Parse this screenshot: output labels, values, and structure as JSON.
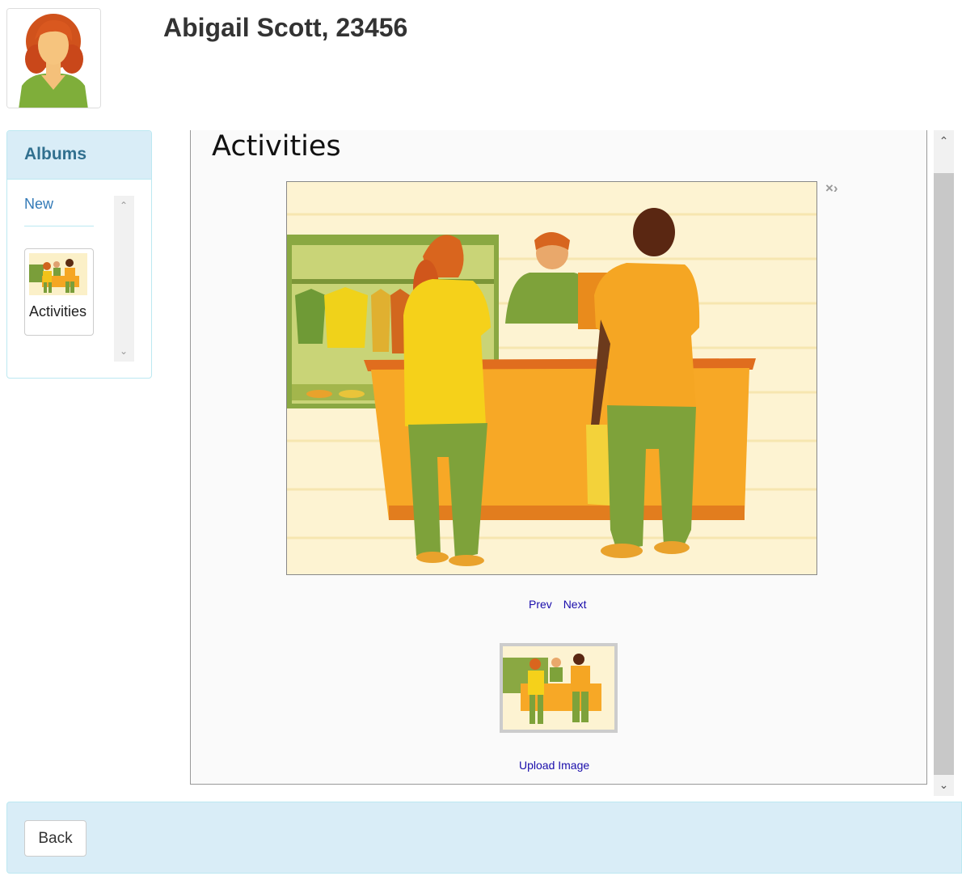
{
  "header": {
    "title": "Abigail Scott, 23456",
    "avatar_icon": "person-avatar-icon"
  },
  "albums": {
    "heading": "Albums",
    "new_label": "New",
    "items": [
      {
        "label": "Activities"
      }
    ]
  },
  "viewer": {
    "album_title": "Activities",
    "close_label": "×›",
    "prev_label": "Prev",
    "next_label": "Next",
    "upload_label": "Upload Image"
  },
  "footer": {
    "back_label": "Back"
  },
  "colors": {
    "panel_heading_bg": "#d9edf7",
    "panel_border": "#bce8f1",
    "heading_text": "#31708f",
    "link": "#337ab7",
    "nav_link": "#1a0dab"
  }
}
